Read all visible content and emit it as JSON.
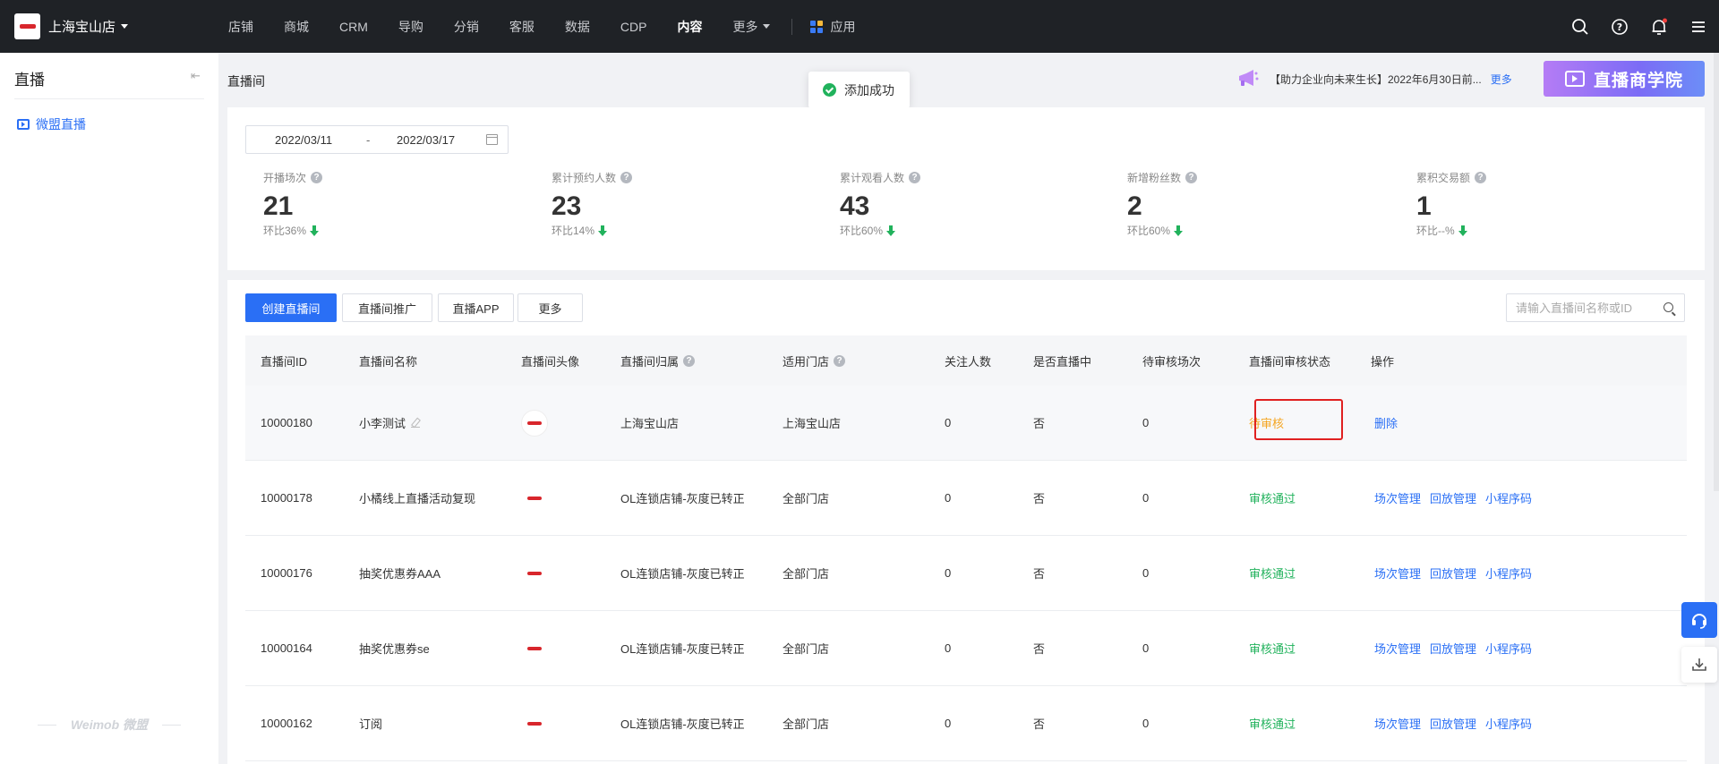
{
  "topbar": {
    "store_name": "上海宝山店",
    "nav": [
      "店铺",
      "商城",
      "CRM",
      "导购",
      "分销",
      "客服",
      "数据",
      "CDP",
      "内容",
      "更多"
    ],
    "active_nav": "内容",
    "app_label": "应用",
    "icons": [
      "search-icon",
      "help-icon",
      "bell-icon",
      "menu-icon"
    ]
  },
  "sidebar": {
    "title": "直播",
    "items": [
      {
        "label": "微盟直播",
        "icon": "live-icon",
        "active": true
      }
    ],
    "brand": "Weimob 微盟"
  },
  "page": {
    "title": "直播间",
    "toast": "添加成功",
    "notice": "【助力企业向未来生长】2022年6月30日前...",
    "notice_more": "更多",
    "banner": "直播商学院"
  },
  "stats": {
    "date_start": "2022/03/11",
    "date_sep": "-",
    "date_end": "2022/03/17",
    "items": [
      {
        "label": "开播场次",
        "value": "21",
        "sub": "环比36%"
      },
      {
        "label": "累计预约人数",
        "value": "23",
        "sub": "环比14%"
      },
      {
        "label": "累计观看人数",
        "value": "43",
        "sub": "环比60%"
      },
      {
        "label": "新增粉丝数",
        "value": "2",
        "sub": "环比60%"
      },
      {
        "label": "累积交易额",
        "value": "1",
        "sub": "环比--%"
      }
    ]
  },
  "toolbar": {
    "create": "创建直播间",
    "promote": "直播间推广",
    "app": "直播APP",
    "more": "更多",
    "search_placeholder": "请输入直播间名称或ID"
  },
  "table": {
    "headers": [
      "直播间ID",
      "直播间名称",
      "直播间头像",
      "直播间归属",
      "适用门店",
      "关注人数",
      "是否直播中",
      "待审核场次",
      "直播间审核状态",
      "操作"
    ],
    "rows": [
      {
        "id": "10000180",
        "name": "小李测试",
        "owner": "上海宝山店",
        "store": "上海宝山店",
        "fans": "0",
        "live": "否",
        "pending": "0",
        "status": "待审核",
        "status_type": "pending",
        "ops": [
          "删除"
        ]
      },
      {
        "id": "10000178",
        "name": "小橘线上直播活动复现",
        "owner": "OL连锁店铺-灰度已转正",
        "store": "全部门店",
        "fans": "0",
        "live": "否",
        "pending": "0",
        "status": "审核通过",
        "status_type": "ok",
        "ops": [
          "场次管理",
          "回放管理",
          "小程序码"
        ]
      },
      {
        "id": "10000176",
        "name": "抽奖优惠券AAA",
        "owner": "OL连锁店铺-灰度已转正",
        "store": "全部门店",
        "fans": "0",
        "live": "否",
        "pending": "0",
        "status": "审核通过",
        "status_type": "ok",
        "ops": [
          "场次管理",
          "回放管理",
          "小程序码"
        ]
      },
      {
        "id": "10000164",
        "name": "抽奖优惠券se",
        "owner": "OL连锁店铺-灰度已转正",
        "store": "全部门店",
        "fans": "0",
        "live": "否",
        "pending": "0",
        "status": "审核通过",
        "status_type": "ok",
        "ops": [
          "场次管理",
          "回放管理",
          "小程序码"
        ]
      },
      {
        "id": "10000162",
        "name": "订阅",
        "owner": "OL连锁店铺-灰度已转正",
        "store": "全部门店",
        "fans": "0",
        "live": "否",
        "pending": "0",
        "status": "审核通过",
        "status_type": "ok",
        "ops": [
          "场次管理",
          "回放管理",
          "小程序码"
        ]
      }
    ]
  },
  "colors": {
    "primary": "#2a6ff5",
    "pending": "#f5a623",
    "ok": "#21b25c",
    "highlight": "#e02020"
  }
}
